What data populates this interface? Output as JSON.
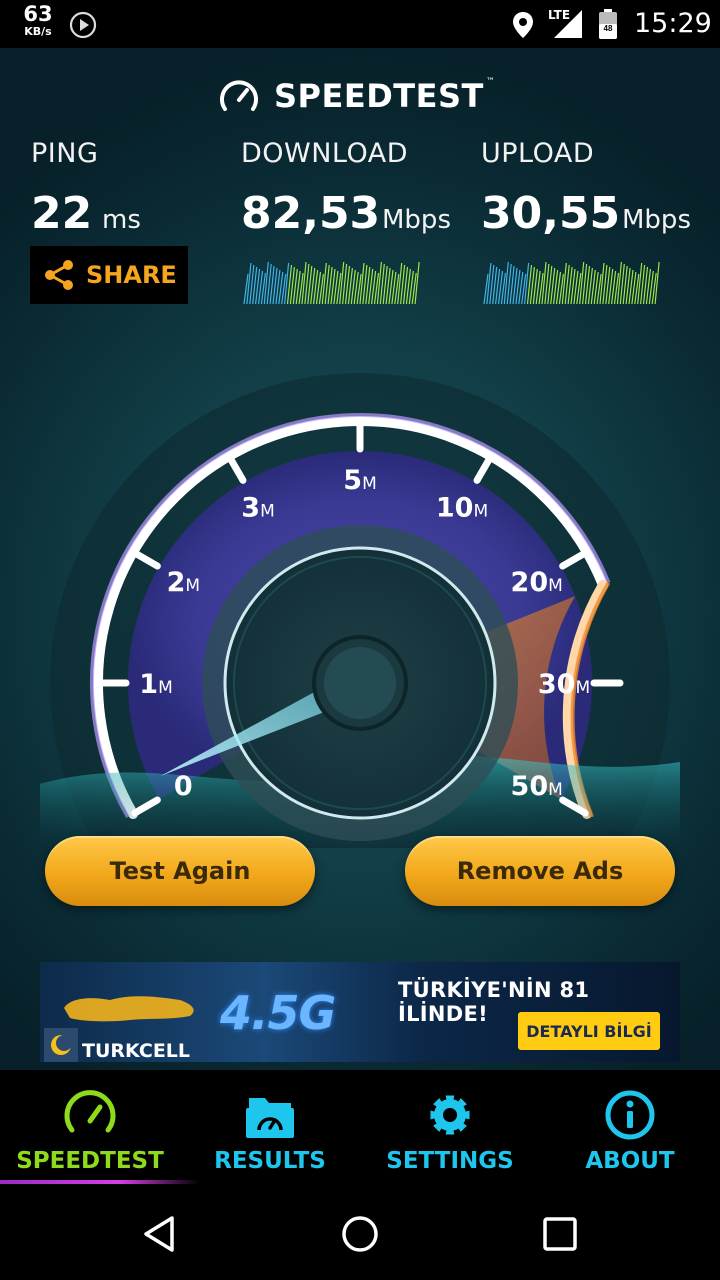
{
  "status_bar": {
    "net_speed": "63",
    "net_unit": "KB/s",
    "network": "LTE",
    "battery": "48",
    "time": "15:29"
  },
  "logo": {
    "text": "SPEEDTEST",
    "tm": "™"
  },
  "ping": {
    "label": "PING",
    "value": "22",
    "unit": "ms"
  },
  "download": {
    "label": "DOWNLOAD",
    "value": "82,53",
    "unit": "Mbps"
  },
  "upload": {
    "label": "UPLOAD",
    "value": "30,55",
    "unit": "Mbps"
  },
  "share": {
    "label": "SHARE"
  },
  "gauge": {
    "ticks": [
      {
        "num": "0",
        "unit": ""
      },
      {
        "num": "1",
        "unit": "M"
      },
      {
        "num": "2",
        "unit": "M"
      },
      {
        "num": "3",
        "unit": "M"
      },
      {
        "num": "5",
        "unit": "M"
      },
      {
        "num": "10",
        "unit": "M"
      },
      {
        "num": "20",
        "unit": "M"
      },
      {
        "num": "30",
        "unit": "M"
      },
      {
        "num": "50",
        "unit": "M"
      }
    ]
  },
  "buttons": {
    "test_again": "Test Again",
    "remove_ads": "Remove Ads"
  },
  "ad": {
    "headline": "TÜRKİYE'NİN 81 İLİNDE!",
    "cta": "DETAYLI BİLGİ",
    "brand": "TURKCELL",
    "tech": "4.5G"
  },
  "nav": [
    {
      "label": "SPEEDTEST",
      "icon": "speedometer-icon",
      "active": true
    },
    {
      "label": "RESULTS",
      "icon": "results-folder-icon",
      "active": false
    },
    {
      "label": "SETTINGS",
      "icon": "gear-icon",
      "active": false
    },
    {
      "label": "ABOUT",
      "icon": "info-icon",
      "active": false
    }
  ],
  "colors": {
    "accent_orange": "#f6a51e",
    "nav_cyan": "#1ec6ee",
    "nav_active_green": "#8edb1c",
    "button_gold": "#f2a81a"
  }
}
